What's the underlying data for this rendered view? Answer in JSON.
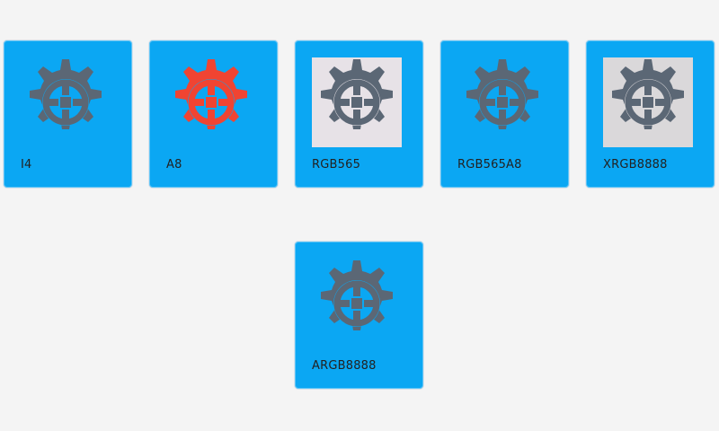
{
  "cards": [
    {
      "label": "I4",
      "icon": "gear-icon",
      "icon_color": "#5b6775",
      "icon_background": "none"
    },
    {
      "label": "A8",
      "icon": "gear-icon",
      "icon_color": "#f04432",
      "icon_background": "none"
    },
    {
      "label": "RGB565",
      "icon": "gear-icon",
      "icon_color": "#5b6775",
      "icon_background": "#e7e2e7"
    },
    {
      "label": "RGB565A8",
      "icon": "gear-icon",
      "icon_color": "#5b6775",
      "icon_background": "none"
    },
    {
      "label": "XRGB8888",
      "icon": "gear-icon",
      "icon_color": "#5b6775",
      "icon_background": "#dad8da"
    },
    {
      "label": "ARGB8888",
      "icon": "gear-icon",
      "icon_color": "#5b6775",
      "icon_background": "none"
    }
  ],
  "colors": {
    "page_background": "#f4f4f4",
    "card_background": "#0ba7f3",
    "label_text": "#222222"
  }
}
